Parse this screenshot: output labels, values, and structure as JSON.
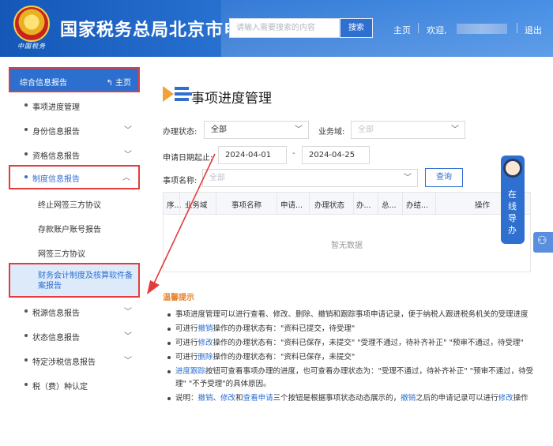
{
  "header": {
    "site_title": "国家税务总局北京市电",
    "search_placeholder": "请输入需要搜索的内容",
    "search_button": "搜索",
    "home_link": "主页",
    "welcome": "欢迎,",
    "logout": "退出",
    "emblem_script": "中国税务"
  },
  "sidebar": {
    "head_title": "综合信息报告",
    "head_home": "主页",
    "items": [
      {
        "label": "事项进度管理"
      },
      {
        "label": "身份信息报告"
      },
      {
        "label": "资格信息报告"
      },
      {
        "label": "制度信息报告"
      },
      {
        "label": "终止网签三方协议"
      },
      {
        "label": "存款账户账号报告"
      },
      {
        "label": "网签三方协议"
      },
      {
        "label": "财务会计制度及核算软件备案报告"
      },
      {
        "label": "税源信息报告"
      },
      {
        "label": "状态信息报告"
      },
      {
        "label": "特定涉税信息报告"
      },
      {
        "label": "税（费）种认定"
      }
    ]
  },
  "main": {
    "title": "事项进度管理",
    "filters": {
      "status_label": "办理状态:",
      "status_value": "全部",
      "domain_label": "业务域:",
      "domain_placeholder": "全部",
      "date_label": "申请日期起止:",
      "date_from": "2024-04-01",
      "date_sep": "-",
      "date_to": "2024-04-25",
      "item_label": "事项名称:",
      "item_placeholder": "全部",
      "query_button": "查询"
    },
    "table": {
      "columns": [
        "序...",
        "业务域",
        "事项名称",
        "申请...",
        "办理状态",
        "办...",
        "总...",
        "办结...",
        "操作"
      ],
      "empty_text": "暂无数据"
    },
    "tips_title": "温馨提示",
    "tips": {
      "t1": "事项进度管理可以进行查看、修改、删除、撤销和跟踪事项申请记录，便于纳税人跟进税务机关的受理进度",
      "t2_a": "可进行",
      "t2_link": "撤销",
      "t2_b": "操作的办理状态有：\"资料已提交，待受理\"",
      "t3_a": "可进行",
      "t3_link": "修改",
      "t3_b": "操作的办理状态有：\"资料已保存，未提交\" \"受理不通过，待补齐补正\" \"预审不通过，待受理\"",
      "t4_a": "可进行",
      "t4_link": "删除",
      "t4_b": "操作的办理状态有：\"资料已保存，未提交\"",
      "t5_link": "进度跟踪",
      "t5_b": "按钮可查看事项办理的进度，也可查看办理状态为：\"受理不通过，待补齐补正\" \"预审不通过，待受理\" \"不予受理\"的具体原因。",
      "t6_a": "说明：",
      "t6_l1": "撤销",
      "t6_s1": "、",
      "t6_l2": "修改",
      "t6_s2": "和",
      "t6_l3": "查看申请",
      "t6_b": "三个按钮是根据事项状态动态展示的，",
      "t6_l4": "撤销",
      "t6_c": "之后的申请记录可以进行",
      "t6_l5": "修改",
      "t6_d": "操作"
    }
  },
  "guide": {
    "text": "在线导办"
  },
  "colors": {
    "primary": "#2f6fcf",
    "highlight": "#e43c3c",
    "tip": "#e8812c"
  }
}
